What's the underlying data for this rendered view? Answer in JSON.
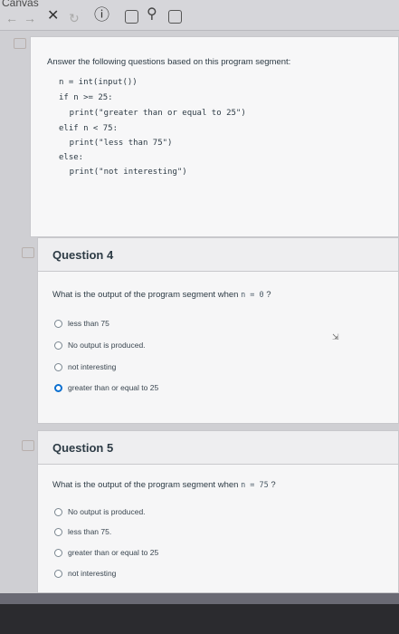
{
  "app": {
    "title": "Canvas"
  },
  "toolbar": {
    "back_icon": "←",
    "forward_icon": "→",
    "close_icon": "✕",
    "reload_icon": "↻",
    "info_icon": "ⓘ",
    "bookmark_icon": "☐",
    "search_icon": "⚲",
    "calendar_icon": "▦"
  },
  "previous_question": {
    "prompt": "Answer the following questions based on this program segment:",
    "code_lines": [
      "n = int(input())",
      "if n >= 25:",
      "    print(\"greater than or equal to 25\")",
      "elif n < 75:",
      "    print(\"less than 75\")",
      "else:",
      "    print(\"not interesting\")"
    ]
  },
  "questions": [
    {
      "title": "Question 4",
      "text": "What is the output of the program segment when",
      "code": "n = 0",
      "suffix": "?",
      "options": [
        {
          "label": "less than 75",
          "selected": false
        },
        {
          "label": "No output is produced.",
          "selected": false
        },
        {
          "label": "not interesting",
          "selected": false
        },
        {
          "label": "greater than or equal to 25",
          "selected": true
        }
      ]
    },
    {
      "title": "Question 5",
      "text": "What is the output of the program segment when",
      "code": "n = 75",
      "suffix": "?",
      "options": [
        {
          "label": "No output is produced.",
          "selected": false
        },
        {
          "label": "less than 75.",
          "selected": false
        },
        {
          "label": "greater than or equal to 25",
          "selected": false
        },
        {
          "label": "not interesting",
          "selected": false
        }
      ]
    }
  ],
  "colors": {
    "selected_radio": "#0b6fd0",
    "text": "#2d3b45",
    "background": "#cfcfd3"
  }
}
